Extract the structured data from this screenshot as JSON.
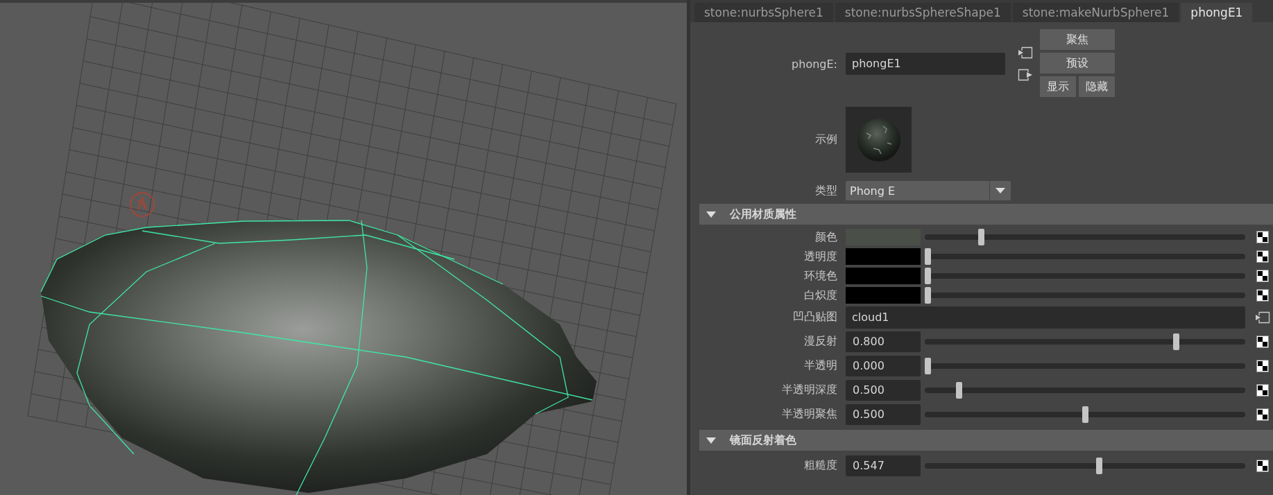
{
  "tabs": [
    {
      "label": "stone:nurbsSphere1",
      "selected": false
    },
    {
      "label": "stone:nurbsSphereShape1",
      "selected": false
    },
    {
      "label": "stone:makeNurbSphere1",
      "selected": false
    },
    {
      "label": "phongE1",
      "selected": true
    }
  ],
  "node_name": {
    "label": "phongE:",
    "value": "phongE1"
  },
  "buttons": [
    "聚焦",
    "预设",
    "显示",
    "隐藏"
  ],
  "sample": {
    "label": "示例"
  },
  "type": {
    "label": "类型",
    "value": "Phong E"
  },
  "sections": [
    {
      "title": "公用材质属性",
      "expanded": true,
      "rows": [
        {
          "kind": "color",
          "label": "颜色",
          "color": "#4a4f48",
          "level": 0.17
        },
        {
          "kind": "color",
          "label": "透明度",
          "color": "#000000",
          "level": 0
        },
        {
          "kind": "color",
          "label": "环境色",
          "color": "#000000",
          "level": 0
        },
        {
          "kind": "color",
          "label": "白炽度",
          "color": "#000000",
          "level": 0
        },
        {
          "kind": "map",
          "label": "凹凸贴图",
          "value": "cloud1"
        },
        {
          "kind": "number",
          "label": "漫反射",
          "value": "0.800",
          "level": 0.79
        },
        {
          "kind": "number",
          "label": "半透明",
          "value": "0.000",
          "level": 0
        },
        {
          "kind": "number",
          "label": "半透明深度",
          "value": "0.500",
          "level": 0.1
        },
        {
          "kind": "number",
          "label": "半透明聚焦",
          "value": "0.500",
          "level": 0.5
        }
      ]
    },
    {
      "title": "镜面反射着色",
      "expanded": true,
      "rows": [
        {
          "kind": "number",
          "label": "粗糙度",
          "value": "0.547",
          "level": 0.545
        }
      ]
    }
  ]
}
